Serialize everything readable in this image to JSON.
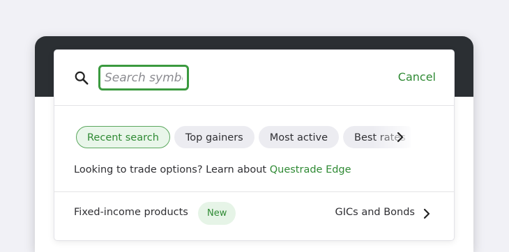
{
  "search": {
    "placeholder": "Search symbol",
    "cancel_label": "Cancel"
  },
  "chips": [
    {
      "label": "Recent search",
      "active": true
    },
    {
      "label": "Top gainers",
      "active": false
    },
    {
      "label": "Most active",
      "active": false
    },
    {
      "label": "Best rates",
      "active": false
    }
  ],
  "options_prompt": {
    "text": "Looking to trade options? Learn about ",
    "link_label": "Questrade Edge"
  },
  "fixed_income": {
    "label": "Fixed-income products",
    "badge": "New",
    "link_label": "GICs and Bonds"
  },
  "colors": {
    "accent": "#2f8a34",
    "background": "#f1f1f6",
    "device_bar": "#2b2f33"
  },
  "icons": [
    "search-icon",
    "chevron-right-icon"
  ]
}
